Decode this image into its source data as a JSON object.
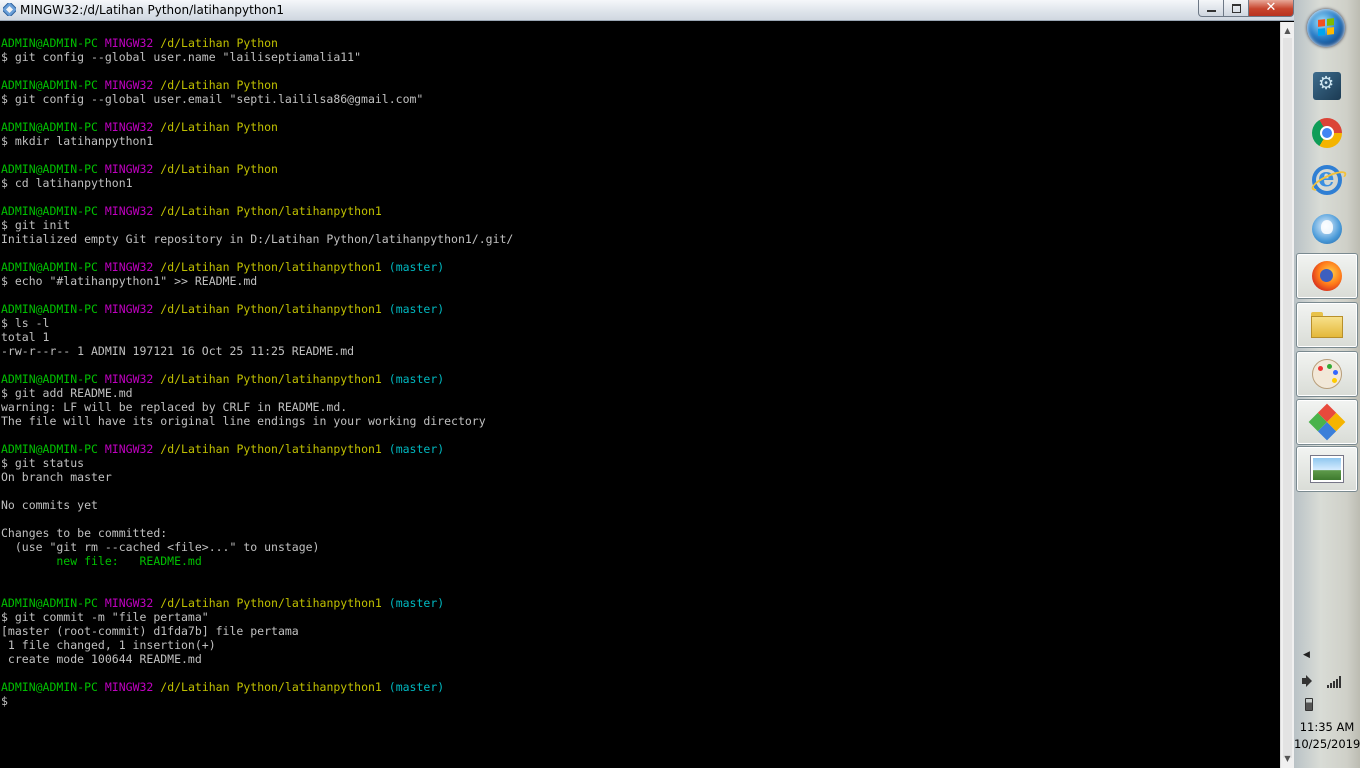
{
  "window": {
    "title": "MINGW32:/d/Latihan Python/latihanpython1",
    "icon": "git-bash-icon",
    "close_label": "✕"
  },
  "colors": {
    "user": "#00c000",
    "host": "#c000c0",
    "path": "#c0c000",
    "branch": "#00b8c0",
    "text": "#c0c0c0",
    "background": "#000000"
  },
  "terminal": {
    "prompt_user": "ADMIN@ADMIN-PC",
    "prompt_host": "MINGW32",
    "lines": [
      {
        "type": "prompt",
        "path": "/d/Latihan Python",
        "branch": ""
      },
      {
        "type": "text",
        "text": "$ git config --global user.name \"lailiseptiamalia11\""
      },
      {
        "type": "blank"
      },
      {
        "type": "prompt",
        "path": "/d/Latihan Python",
        "branch": ""
      },
      {
        "type": "text",
        "text": "$ git config --global user.email \"septi.laililsa86@gmail.com\""
      },
      {
        "type": "blank"
      },
      {
        "type": "prompt",
        "path": "/d/Latihan Python",
        "branch": ""
      },
      {
        "type": "text",
        "text": "$ mkdir latihanpython1"
      },
      {
        "type": "blank"
      },
      {
        "type": "prompt",
        "path": "/d/Latihan Python",
        "branch": ""
      },
      {
        "type": "text",
        "text": "$ cd latihanpython1"
      },
      {
        "type": "blank"
      },
      {
        "type": "prompt",
        "path": "/d/Latihan Python/latihanpython1",
        "branch": ""
      },
      {
        "type": "text",
        "text": "$ git init"
      },
      {
        "type": "text",
        "text": "Initialized empty Git repository in D:/Latihan Python/latihanpython1/.git/"
      },
      {
        "type": "blank"
      },
      {
        "type": "prompt",
        "path": "/d/Latihan Python/latihanpython1",
        "branch": "(master)"
      },
      {
        "type": "text",
        "text": "$ echo \"#latihanpython1\" >> README.md"
      },
      {
        "type": "blank"
      },
      {
        "type": "prompt",
        "path": "/d/Latihan Python/latihanpython1",
        "branch": "(master)"
      },
      {
        "type": "text",
        "text": "$ ls -l"
      },
      {
        "type": "text",
        "text": "total 1"
      },
      {
        "type": "text",
        "text": "-rw-r--r-- 1 ADMIN 197121 16 Oct 25 11:25 README.md"
      },
      {
        "type": "blank"
      },
      {
        "type": "prompt",
        "path": "/d/Latihan Python/latihanpython1",
        "branch": "(master)"
      },
      {
        "type": "text",
        "text": "$ git add README.md"
      },
      {
        "type": "text",
        "text": "warning: LF will be replaced by CRLF in README.md."
      },
      {
        "type": "text",
        "text": "The file will have its original line endings in your working directory"
      },
      {
        "type": "blank"
      },
      {
        "type": "prompt",
        "path": "/d/Latihan Python/latihanpython1",
        "branch": "(master)"
      },
      {
        "type": "text",
        "text": "$ git status"
      },
      {
        "type": "text",
        "text": "On branch master"
      },
      {
        "type": "blank"
      },
      {
        "type": "text",
        "text": "No commits yet"
      },
      {
        "type": "blank"
      },
      {
        "type": "text",
        "text": "Changes to be committed:"
      },
      {
        "type": "text",
        "text": "  (use \"git rm --cached <file>...\" to unstage)"
      },
      {
        "type": "staged",
        "text": "        new file:   README.md"
      },
      {
        "type": "blank"
      },
      {
        "type": "blank"
      },
      {
        "type": "prompt",
        "path": "/d/Latihan Python/latihanpython1",
        "branch": "(master)"
      },
      {
        "type": "text",
        "text": "$ git commit -m \"file pertama\""
      },
      {
        "type": "text",
        "text": "[master (root-commit) d1fda7b] file pertama"
      },
      {
        "type": "text",
        "text": " 1 file changed, 1 insertion(+)"
      },
      {
        "type": "text",
        "text": " create mode 100644 README.md"
      },
      {
        "type": "blank"
      },
      {
        "type": "prompt",
        "path": "/d/Latihan Python/latihanpython1",
        "branch": "(master)"
      },
      {
        "type": "text",
        "text": "$"
      }
    ]
  },
  "taskbar": {
    "items": [
      {
        "name": "app-launcher",
        "icon": "launcher-icon"
      },
      {
        "name": "chrome",
        "icon": "chrome-icon"
      },
      {
        "name": "internet-explorer",
        "icon": "internet-explorer-icon"
      },
      {
        "name": "thunderbird",
        "icon": "thunderbird-icon"
      },
      {
        "name": "firefox",
        "icon": "firefox-icon"
      },
      {
        "name": "file-explorer",
        "icon": "folder-icon"
      },
      {
        "name": "paint",
        "icon": "paint-palette-icon"
      },
      {
        "name": "app-kite",
        "icon": "kite-icon"
      },
      {
        "name": "photo-viewer",
        "icon": "photo-icon"
      }
    ],
    "clock_time": "11:35 AM",
    "clock_date": "10/25/2019"
  }
}
